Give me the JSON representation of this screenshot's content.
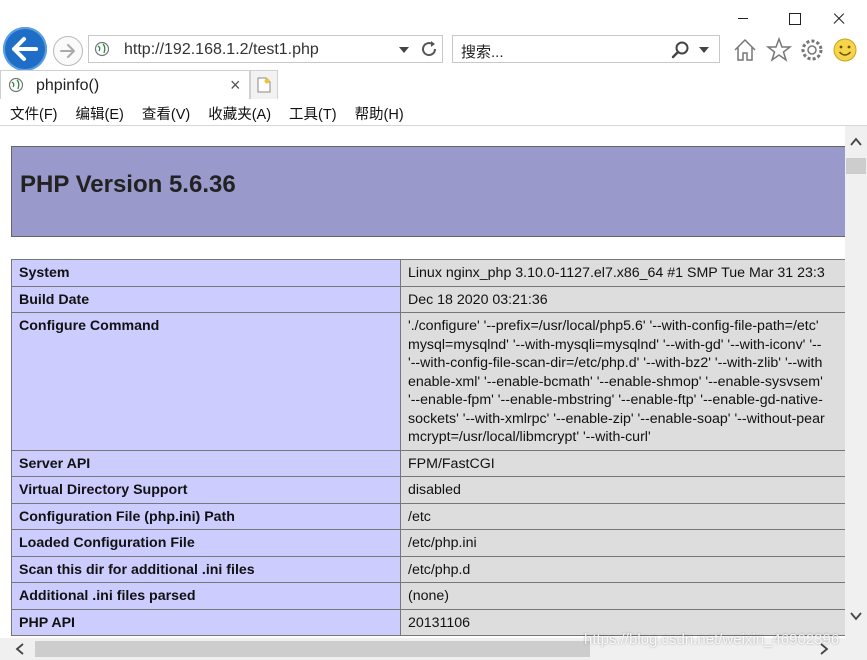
{
  "browser": {
    "url": "http://192.168.1.2/test1.php",
    "search_placeholder": "搜索...",
    "tab_title": "phpinfo()",
    "tab_close": "×"
  },
  "menu": [
    "文件(F)",
    "编辑(E)",
    "查看(V)",
    "收藏夹(A)",
    "工具(T)",
    "帮助(H)"
  ],
  "page": {
    "title": "PHP Version 5.6.36",
    "rows": [
      {
        "key": "System",
        "value": [
          "Linux nginx_php 3.10.0-1127.el7.x86_64 #1 SMP Tue Mar 31 23:3"
        ]
      },
      {
        "key": "Build Date",
        "value": [
          "Dec 18 2020 03:21:36"
        ]
      },
      {
        "key": "Configure Command",
        "value": [
          "'./configure' '--prefix=/usr/local/php5.6' '--with-config-file-path=/etc'",
          "mysql=mysqlnd' '--with-mysqli=mysqlnd' '--with-gd' '--with-iconv' '--",
          "'--with-config-file-scan-dir=/etc/php.d' '--with-bz2' '--with-zlib' '--with",
          "enable-xml' '--enable-bcmath' '--enable-shmop' '--enable-sysvsem'",
          "'--enable-fpm' '--enable-mbstring' '--enable-ftp' '--enable-gd-native-",
          "sockets' '--with-xmlrpc' '--enable-zip' '--enable-soap' '--without-pear",
          "mcrypt=/usr/local/libmcrypt' '--with-curl'"
        ]
      },
      {
        "key": "Server API",
        "value": [
          "FPM/FastCGI"
        ]
      },
      {
        "key": "Virtual Directory Support",
        "value": [
          "disabled"
        ]
      },
      {
        "key": "Configuration File (php.ini) Path",
        "value": [
          "/etc"
        ]
      },
      {
        "key": "Loaded Configuration File",
        "value": [
          "/etc/php.ini"
        ]
      },
      {
        "key": "Scan this dir for additional .ini files",
        "value": [
          "/etc/php.d"
        ]
      },
      {
        "key": "Additional .ini files parsed",
        "value": [
          "(none)"
        ]
      },
      {
        "key": "PHP API",
        "value": [
          "20131106"
        ]
      }
    ]
  },
  "watermark": "https://blog.csdn.net/weixin_46902396",
  "colors": {
    "header_bg": "#9999cc",
    "key_bg": "#ccccff",
    "value_bg": "#dddddd",
    "back_button": "#1e6ec8"
  }
}
